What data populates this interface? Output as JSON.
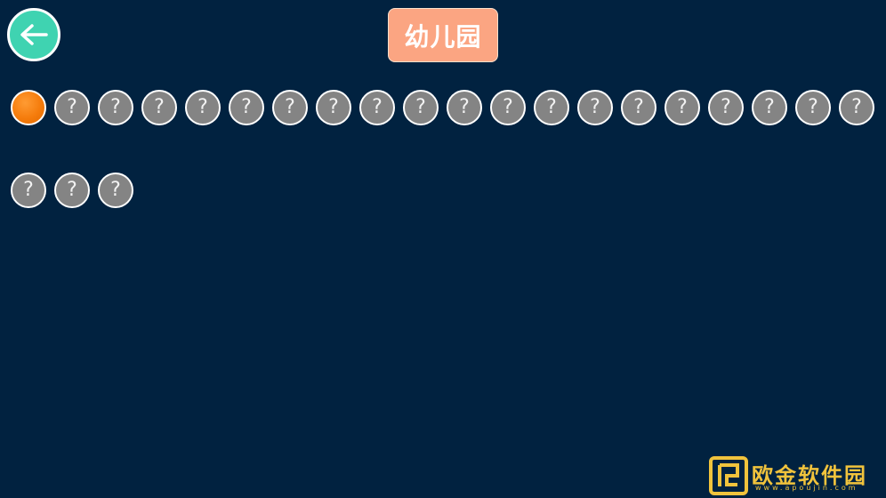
{
  "header": {
    "back_button": {
      "icon": "arrow-left-icon"
    },
    "title": "幼儿园"
  },
  "levels": [
    {
      "state": "unlocked",
      "label": ""
    },
    {
      "state": "locked",
      "label": "?"
    },
    {
      "state": "locked",
      "label": "?"
    },
    {
      "state": "locked",
      "label": "?"
    },
    {
      "state": "locked",
      "label": "?"
    },
    {
      "state": "locked",
      "label": "?"
    },
    {
      "state": "locked",
      "label": "?"
    },
    {
      "state": "locked",
      "label": "?"
    },
    {
      "state": "locked",
      "label": "?"
    },
    {
      "state": "locked",
      "label": "?"
    },
    {
      "state": "locked",
      "label": "?"
    },
    {
      "state": "locked",
      "label": "?"
    },
    {
      "state": "locked",
      "label": "?"
    },
    {
      "state": "locked",
      "label": "?"
    },
    {
      "state": "locked",
      "label": "?"
    },
    {
      "state": "locked",
      "label": "?"
    },
    {
      "state": "locked",
      "label": "?"
    },
    {
      "state": "locked",
      "label": "?"
    },
    {
      "state": "locked",
      "label": "?"
    },
    {
      "state": "locked",
      "label": "?"
    },
    {
      "state": "locked",
      "label": "?"
    },
    {
      "state": "locked",
      "label": "?"
    },
    {
      "state": "locked",
      "label": "?"
    }
  ],
  "watermark": {
    "text": "欧金软件园",
    "url": "www.apoujin.com"
  },
  "colors": {
    "background": "#012240",
    "back_button": "#3fd3b1",
    "title_badge": "#fba582",
    "level_locked": "#848484",
    "level_unlocked": "#f57c0c",
    "watermark": "#f1c33c"
  }
}
